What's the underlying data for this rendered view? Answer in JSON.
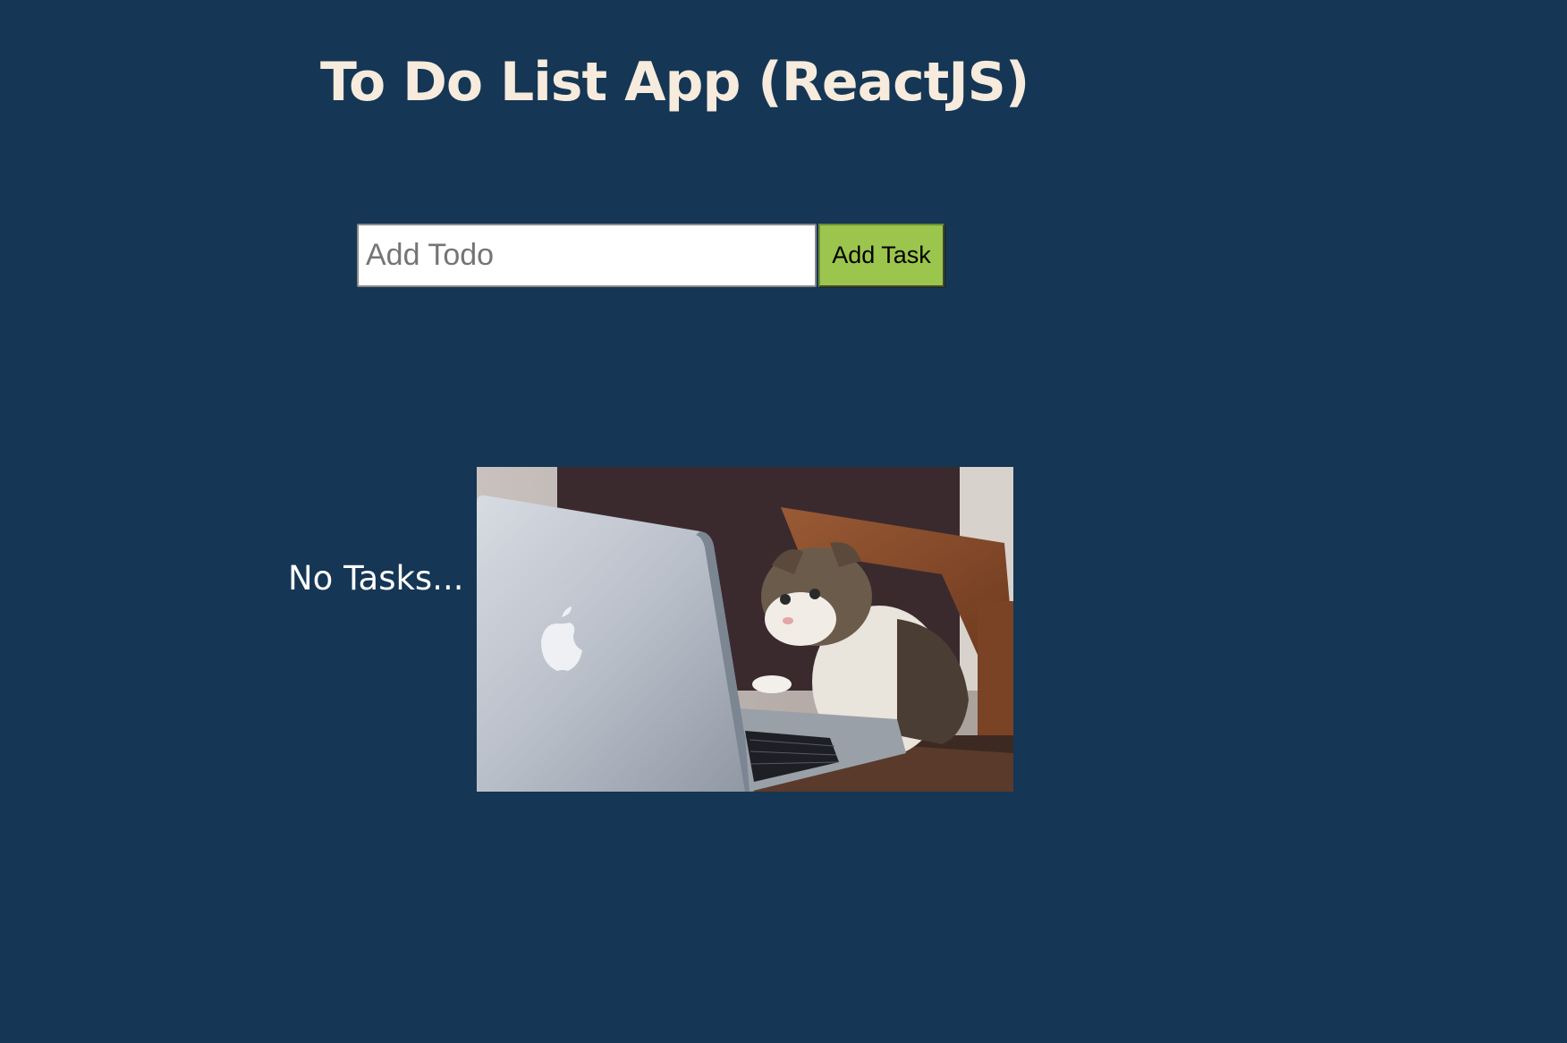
{
  "app": {
    "title": "To Do List App (ReactJS)"
  },
  "form": {
    "input_value": "",
    "input_placeholder": "Add Todo",
    "add_button_label": "Add Task"
  },
  "tasks": {
    "items": [],
    "empty_text": "No Tasks..."
  },
  "image": {
    "description_icon": "cat-at-laptop-image"
  },
  "colors": {
    "background": "#153654",
    "title": "#f6ebdc",
    "button": "#9bc54d"
  }
}
